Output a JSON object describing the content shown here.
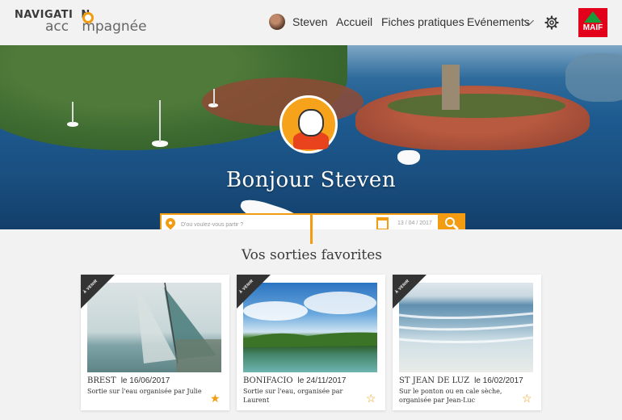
{
  "header": {
    "logo_top": "NAVIGATI  N",
    "logo_bottom": "acc   mpagnée",
    "user_name": "Steven",
    "nav_home": "Accueil",
    "nav_sheets": "Fiches pratiques",
    "nav_events": "Evénements",
    "partner_logo_text": "MAIF"
  },
  "hero": {
    "greeting": "Bonjour Steven",
    "search_placeholder": "D'où voulez-vous partir ?",
    "search_date": "13 / 04 / 2017"
  },
  "favorites": {
    "title": "Vos sorties favorites",
    "cards": [
      {
        "badge": "À VENIR",
        "place": "BREST",
        "date": "le 16/06/2017",
        "desc": "Sortie sur l'eau organisée par Julie",
        "favorite": "filled"
      },
      {
        "badge": "À VENIR",
        "place": "BONIFACIO",
        "date": "le 24/11/2017",
        "desc": "Sortie sur l'eau, organisée par Laurent",
        "favorite": "outline"
      },
      {
        "badge": "À VENIR",
        "place": "ST JEAN DE LUZ",
        "date": "le 16/02/2017",
        "desc": "Sur le ponton ou en cale sèche, organisée par Jean-Luc",
        "favorite": "outline"
      }
    ]
  },
  "colors": {
    "accent": "#f39c12",
    "badge": "#333333",
    "partner_red": "#e3001b",
    "partner_green": "#1a9b3a"
  },
  "icons": [
    "map-pin-icon",
    "calendar-icon",
    "search-icon",
    "gear-icon",
    "chevron-down-icon",
    "star-icon"
  ]
}
